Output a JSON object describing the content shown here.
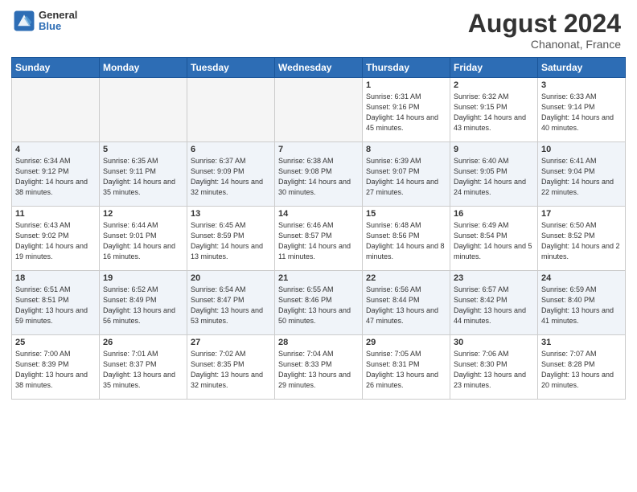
{
  "header": {
    "logo_general": "General",
    "logo_blue": "Blue",
    "month_title": "August 2024",
    "location": "Chanonat, France"
  },
  "days_of_week": [
    "Sunday",
    "Monday",
    "Tuesday",
    "Wednesday",
    "Thursday",
    "Friday",
    "Saturday"
  ],
  "weeks": [
    [
      {
        "day": "",
        "empty": true
      },
      {
        "day": "",
        "empty": true
      },
      {
        "day": "",
        "empty": true
      },
      {
        "day": "",
        "empty": true
      },
      {
        "day": "1",
        "sunrise": "6:31 AM",
        "sunset": "9:16 PM",
        "daylight": "14 hours and 45 minutes."
      },
      {
        "day": "2",
        "sunrise": "6:32 AM",
        "sunset": "9:15 PM",
        "daylight": "14 hours and 43 minutes."
      },
      {
        "day": "3",
        "sunrise": "6:33 AM",
        "sunset": "9:14 PM",
        "daylight": "14 hours and 40 minutes."
      }
    ],
    [
      {
        "day": "4",
        "sunrise": "6:34 AM",
        "sunset": "9:12 PM",
        "daylight": "14 hours and 38 minutes."
      },
      {
        "day": "5",
        "sunrise": "6:35 AM",
        "sunset": "9:11 PM",
        "daylight": "14 hours and 35 minutes."
      },
      {
        "day": "6",
        "sunrise": "6:37 AM",
        "sunset": "9:09 PM",
        "daylight": "14 hours and 32 minutes."
      },
      {
        "day": "7",
        "sunrise": "6:38 AM",
        "sunset": "9:08 PM",
        "daylight": "14 hours and 30 minutes."
      },
      {
        "day": "8",
        "sunrise": "6:39 AM",
        "sunset": "9:07 PM",
        "daylight": "14 hours and 27 minutes."
      },
      {
        "day": "9",
        "sunrise": "6:40 AM",
        "sunset": "9:05 PM",
        "daylight": "14 hours and 24 minutes."
      },
      {
        "day": "10",
        "sunrise": "6:41 AM",
        "sunset": "9:04 PM",
        "daylight": "14 hours and 22 minutes."
      }
    ],
    [
      {
        "day": "11",
        "sunrise": "6:43 AM",
        "sunset": "9:02 PM",
        "daylight": "14 hours and 19 minutes."
      },
      {
        "day": "12",
        "sunrise": "6:44 AM",
        "sunset": "9:01 PM",
        "daylight": "14 hours and 16 minutes."
      },
      {
        "day": "13",
        "sunrise": "6:45 AM",
        "sunset": "8:59 PM",
        "daylight": "14 hours and 13 minutes."
      },
      {
        "day": "14",
        "sunrise": "6:46 AM",
        "sunset": "8:57 PM",
        "daylight": "14 hours and 11 minutes."
      },
      {
        "day": "15",
        "sunrise": "6:48 AM",
        "sunset": "8:56 PM",
        "daylight": "14 hours and 8 minutes."
      },
      {
        "day": "16",
        "sunrise": "6:49 AM",
        "sunset": "8:54 PM",
        "daylight": "14 hours and 5 minutes."
      },
      {
        "day": "17",
        "sunrise": "6:50 AM",
        "sunset": "8:52 PM",
        "daylight": "14 hours and 2 minutes."
      }
    ],
    [
      {
        "day": "18",
        "sunrise": "6:51 AM",
        "sunset": "8:51 PM",
        "daylight": "13 hours and 59 minutes."
      },
      {
        "day": "19",
        "sunrise": "6:52 AM",
        "sunset": "8:49 PM",
        "daylight": "13 hours and 56 minutes."
      },
      {
        "day": "20",
        "sunrise": "6:54 AM",
        "sunset": "8:47 PM",
        "daylight": "13 hours and 53 minutes."
      },
      {
        "day": "21",
        "sunrise": "6:55 AM",
        "sunset": "8:46 PM",
        "daylight": "13 hours and 50 minutes."
      },
      {
        "day": "22",
        "sunrise": "6:56 AM",
        "sunset": "8:44 PM",
        "daylight": "13 hours and 47 minutes."
      },
      {
        "day": "23",
        "sunrise": "6:57 AM",
        "sunset": "8:42 PM",
        "daylight": "13 hours and 44 minutes."
      },
      {
        "day": "24",
        "sunrise": "6:59 AM",
        "sunset": "8:40 PM",
        "daylight": "13 hours and 41 minutes."
      }
    ],
    [
      {
        "day": "25",
        "sunrise": "7:00 AM",
        "sunset": "8:39 PM",
        "daylight": "13 hours and 38 minutes."
      },
      {
        "day": "26",
        "sunrise": "7:01 AM",
        "sunset": "8:37 PM",
        "daylight": "13 hours and 35 minutes."
      },
      {
        "day": "27",
        "sunrise": "7:02 AM",
        "sunset": "8:35 PM",
        "daylight": "13 hours and 32 minutes."
      },
      {
        "day": "28",
        "sunrise": "7:04 AM",
        "sunset": "8:33 PM",
        "daylight": "13 hours and 29 minutes."
      },
      {
        "day": "29",
        "sunrise": "7:05 AM",
        "sunset": "8:31 PM",
        "daylight": "13 hours and 26 minutes."
      },
      {
        "day": "30",
        "sunrise": "7:06 AM",
        "sunset": "8:30 PM",
        "daylight": "13 hours and 23 minutes."
      },
      {
        "day": "31",
        "sunrise": "7:07 AM",
        "sunset": "8:28 PM",
        "daylight": "13 hours and 20 minutes."
      }
    ]
  ]
}
